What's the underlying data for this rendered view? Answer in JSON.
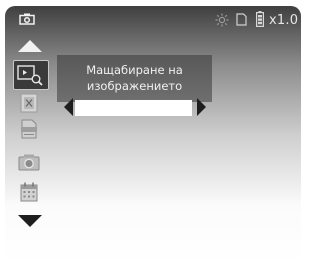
{
  "status_bar": {
    "zoom": "x1.0",
    "icons": [
      "camera-icon",
      "brightness-icon",
      "sd-card-icon",
      "battery-icon"
    ]
  },
  "menu": {
    "items": [
      {
        "icon": "image-zoom-icon",
        "selected": true
      },
      {
        "icon": "delete-x-icon",
        "selected": false
      },
      {
        "icon": "document-icon",
        "selected": false
      },
      {
        "icon": "photo-camera-icon",
        "selected": false
      },
      {
        "icon": "calendar-icon",
        "selected": false
      }
    ]
  },
  "setting": {
    "title": "Мащабиране на изображението",
    "value": ""
  },
  "colors": {
    "icon_gray": "#b8b8b8",
    "panel": "#666666",
    "selection_bg": "#3a3a3a"
  }
}
